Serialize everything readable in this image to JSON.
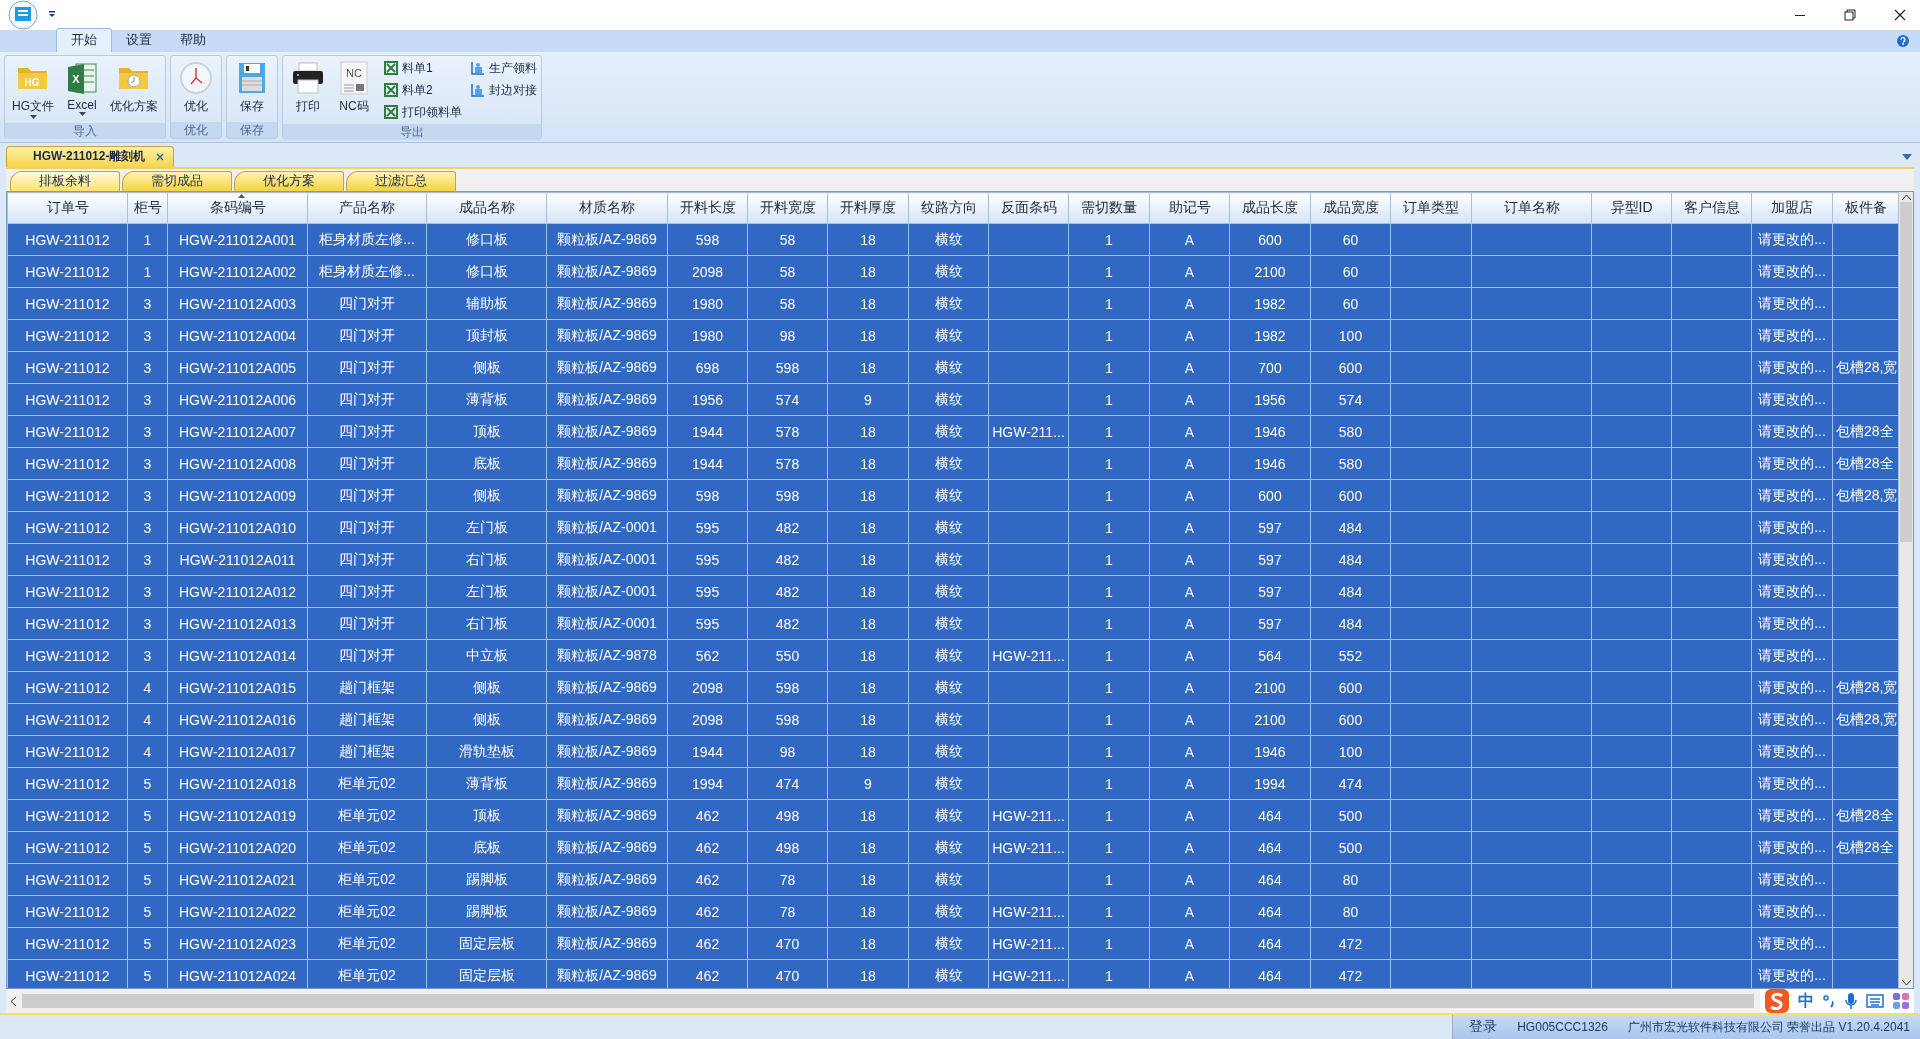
{
  "ribbon": {
    "tabs": [
      {
        "label": "开始",
        "selected": true
      },
      {
        "label": "设置",
        "selected": false
      },
      {
        "label": "帮助",
        "selected": false
      }
    ],
    "groups": [
      {
        "label": "导入",
        "buttons": [
          {
            "kind": "large",
            "label": "HG文件",
            "badge": "HG",
            "has_menu": true
          },
          {
            "kind": "large",
            "label": "Excel",
            "badge": "X",
            "has_menu": true
          },
          {
            "kind": "large",
            "label": "优化方案",
            "has_menu": false
          }
        ]
      },
      {
        "label": "优化",
        "buttons": [
          {
            "kind": "large",
            "label": "优化",
            "has_menu": false
          }
        ]
      },
      {
        "label": "保存",
        "buttons": [
          {
            "kind": "large",
            "label": "保存",
            "has_menu": false
          }
        ]
      },
      {
        "label": "导出",
        "buttons": [
          {
            "kind": "large",
            "label": "打印",
            "has_menu": false
          },
          {
            "kind": "large",
            "label": "NC码",
            "badge": "NC",
            "has_menu": false
          },
          {
            "kind": "small",
            "label": "料单1"
          },
          {
            "kind": "small",
            "label": "料单2"
          },
          {
            "kind": "small",
            "label": "打印领料单"
          },
          {
            "kind": "small",
            "label": "生产领料"
          },
          {
            "kind": "small",
            "label": "封边对接"
          }
        ]
      }
    ]
  },
  "document_tab": {
    "label": "HGW-211012-雕刻机"
  },
  "sub_tabs": [
    {
      "label": "排板余料",
      "selected": true
    },
    {
      "label": "需切成品",
      "selected": false
    },
    {
      "label": "优化方案",
      "selected": false
    },
    {
      "label": "过滤汇总",
      "selected": false
    }
  ],
  "table": {
    "columns": [
      {
        "label": "订单号",
        "sorted": false
      },
      {
        "label": "柜号",
        "sorted": false
      },
      {
        "label": "条码编号",
        "sorted": true
      },
      {
        "label": "产品名称",
        "sorted": false
      },
      {
        "label": "成品名称",
        "sorted": false
      },
      {
        "label": "材质名称",
        "sorted": false
      },
      {
        "label": "开料长度",
        "sorted": false
      },
      {
        "label": "开料宽度",
        "sorted": false
      },
      {
        "label": "开料厚度",
        "sorted": false
      },
      {
        "label": "纹路方向",
        "sorted": false
      },
      {
        "label": "反面条码",
        "sorted": false
      },
      {
        "label": "需切数量",
        "sorted": false
      },
      {
        "label": "助记号",
        "sorted": false
      },
      {
        "label": "成品长度",
        "sorted": false
      },
      {
        "label": "成品宽度",
        "sorted": false
      },
      {
        "label": "订单类型",
        "sorted": false
      },
      {
        "label": "订单名称",
        "sorted": false
      },
      {
        "label": "异型ID",
        "sorted": false
      },
      {
        "label": "客户信息",
        "sorted": false
      },
      {
        "label": "加盟店",
        "sorted": false
      },
      {
        "label": "板件备",
        "sorted": false
      }
    ],
    "rows": [
      {
        "selected": true,
        "cells": [
          "HGW-211012",
          "1",
          "HGW-211012A001",
          "柜身材质左修...",
          "修口板",
          "颗粒板/AZ-9869",
          "598",
          "58",
          "18",
          "横纹",
          "",
          "1",
          "A",
          "600",
          "60",
          "",
          "",
          "",
          "",
          "请更改的...",
          ""
        ]
      },
      {
        "selected": true,
        "cells": [
          "HGW-211012",
          "1",
          "HGW-211012A002",
          "柜身材质左修...",
          "修口板",
          "颗粒板/AZ-9869",
          "2098",
          "58",
          "18",
          "横纹",
          "",
          "1",
          "A",
          "2100",
          "60",
          "",
          "",
          "",
          "",
          "请更改的...",
          ""
        ]
      },
      {
        "selected": true,
        "cells": [
          "HGW-211012",
          "3",
          "HGW-211012A003",
          "四门对开",
          "辅助板",
          "颗粒板/AZ-9869",
          "1980",
          "58",
          "18",
          "横纹",
          "",
          "1",
          "A",
          "1982",
          "60",
          "",
          "",
          "",
          "",
          "请更改的...",
          ""
        ]
      },
      {
        "selected": true,
        "cells": [
          "HGW-211012",
          "3",
          "HGW-211012A004",
          "四门对开",
          "顶封板",
          "颗粒板/AZ-9869",
          "1980",
          "98",
          "18",
          "横纹",
          "",
          "1",
          "A",
          "1982",
          "100",
          "",
          "",
          "",
          "",
          "请更改的...",
          ""
        ]
      },
      {
        "selected": true,
        "cells": [
          "HGW-211012",
          "3",
          "HGW-211012A005",
          "四门对开",
          "侧板",
          "颗粒板/AZ-9869",
          "698",
          "598",
          "18",
          "横纹",
          "",
          "1",
          "A",
          "700",
          "600",
          "",
          "",
          "",
          "",
          "请更改的...",
          "包槽28,宽"
        ]
      },
      {
        "selected": true,
        "cells": [
          "HGW-211012",
          "3",
          "HGW-211012A006",
          "四门对开",
          "薄背板",
          "颗粒板/AZ-9869",
          "1956",
          "574",
          "9",
          "横纹",
          "",
          "1",
          "A",
          "1956",
          "574",
          "",
          "",
          "",
          "",
          "请更改的...",
          ""
        ]
      },
      {
        "selected": true,
        "cells": [
          "HGW-211012",
          "3",
          "HGW-211012A007",
          "四门对开",
          "顶板",
          "颗粒板/AZ-9869",
          "1944",
          "578",
          "18",
          "横纹",
          "HGW-211...",
          "1",
          "A",
          "1946",
          "580",
          "",
          "",
          "",
          "",
          "请更改的...",
          "包槽28全"
        ]
      },
      {
        "selected": true,
        "cells": [
          "HGW-211012",
          "3",
          "HGW-211012A008",
          "四门对开",
          "底板",
          "颗粒板/AZ-9869",
          "1944",
          "578",
          "18",
          "横纹",
          "",
          "1",
          "A",
          "1946",
          "580",
          "",
          "",
          "",
          "",
          "请更改的...",
          "包槽28全"
        ]
      },
      {
        "selected": true,
        "cells": [
          "HGW-211012",
          "3",
          "HGW-211012A009",
          "四门对开",
          "侧板",
          "颗粒板/AZ-9869",
          "598",
          "598",
          "18",
          "横纹",
          "",
          "1",
          "A",
          "600",
          "600",
          "",
          "",
          "",
          "",
          "请更改的...",
          "包槽28,宽"
        ]
      },
      {
        "selected": true,
        "cells": [
          "HGW-211012",
          "3",
          "HGW-211012A010",
          "四门对开",
          "左门板",
          "颗粒板/AZ-0001",
          "595",
          "482",
          "18",
          "横纹",
          "",
          "1",
          "A",
          "597",
          "484",
          "",
          "",
          "",
          "",
          "请更改的...",
          ""
        ]
      },
      {
        "selected": true,
        "cells": [
          "HGW-211012",
          "3",
          "HGW-211012A011",
          "四门对开",
          "右门板",
          "颗粒板/AZ-0001",
          "595",
          "482",
          "18",
          "横纹",
          "",
          "1",
          "A",
          "597",
          "484",
          "",
          "",
          "",
          "",
          "请更改的...",
          ""
        ]
      },
      {
        "selected": true,
        "cells": [
          "HGW-211012",
          "3",
          "HGW-211012A012",
          "四门对开",
          "左门板",
          "颗粒板/AZ-0001",
          "595",
          "482",
          "18",
          "横纹",
          "",
          "1",
          "A",
          "597",
          "484",
          "",
          "",
          "",
          "",
          "请更改的...",
          ""
        ]
      },
      {
        "selected": true,
        "cells": [
          "HGW-211012",
          "3",
          "HGW-211012A013",
          "四门对开",
          "右门板",
          "颗粒板/AZ-0001",
          "595",
          "482",
          "18",
          "横纹",
          "",
          "1",
          "A",
          "597",
          "484",
          "",
          "",
          "",
          "",
          "请更改的...",
          ""
        ]
      },
      {
        "selected": true,
        "cells": [
          "HGW-211012",
          "3",
          "HGW-211012A014",
          "四门对开",
          "中立板",
          "颗粒板/AZ-9878",
          "562",
          "550",
          "18",
          "横纹",
          "HGW-211...",
          "1",
          "A",
          "564",
          "552",
          "",
          "",
          "",
          "",
          "请更改的...",
          ""
        ]
      },
      {
        "selected": true,
        "cells": [
          "HGW-211012",
          "4",
          "HGW-211012A015",
          "趟门框架",
          "侧板",
          "颗粒板/AZ-9869",
          "2098",
          "598",
          "18",
          "横纹",
          "",
          "1",
          "A",
          "2100",
          "600",
          "",
          "",
          "",
          "",
          "请更改的...",
          "包槽28,宽"
        ]
      },
      {
        "selected": true,
        "cells": [
          "HGW-211012",
          "4",
          "HGW-211012A016",
          "趟门框架",
          "侧板",
          "颗粒板/AZ-9869",
          "2098",
          "598",
          "18",
          "横纹",
          "",
          "1",
          "A",
          "2100",
          "600",
          "",
          "",
          "",
          "",
          "请更改的...",
          "包槽28,宽"
        ]
      },
      {
        "selected": true,
        "cells": [
          "HGW-211012",
          "4",
          "HGW-211012A017",
          "趟门框架",
          "滑轨垫板",
          "颗粒板/AZ-9869",
          "1944",
          "98",
          "18",
          "横纹",
          "",
          "1",
          "A",
          "1946",
          "100",
          "",
          "",
          "",
          "",
          "请更改的...",
          ""
        ]
      },
      {
        "selected": true,
        "cells": [
          "HGW-211012",
          "5",
          "HGW-211012A018",
          "柜单元02",
          "薄背板",
          "颗粒板/AZ-9869",
          "1994",
          "474",
          "9",
          "横纹",
          "",
          "1",
          "A",
          "1994",
          "474",
          "",
          "",
          "",
          "",
          "请更改的...",
          ""
        ]
      },
      {
        "selected": true,
        "cells": [
          "HGW-211012",
          "5",
          "HGW-211012A019",
          "柜单元02",
          "顶板",
          "颗粒板/AZ-9869",
          "462",
          "498",
          "18",
          "横纹",
          "HGW-211...",
          "1",
          "A",
          "464",
          "500",
          "",
          "",
          "",
          "",
          "请更改的...",
          "包槽28全"
        ]
      },
      {
        "selected": true,
        "cells": [
          "HGW-211012",
          "5",
          "HGW-211012A020",
          "柜单元02",
          "底板",
          "颗粒板/AZ-9869",
          "462",
          "498",
          "18",
          "横纹",
          "HGW-211...",
          "1",
          "A",
          "464",
          "500",
          "",
          "",
          "",
          "",
          "请更改的...",
          "包槽28全"
        ]
      },
      {
        "selected": true,
        "cells": [
          "HGW-211012",
          "5",
          "HGW-211012A021",
          "柜单元02",
          "踢脚板",
          "颗粒板/AZ-9869",
          "462",
          "78",
          "18",
          "横纹",
          "",
          "1",
          "A",
          "464",
          "80",
          "",
          "",
          "",
          "",
          "请更改的...",
          ""
        ]
      },
      {
        "selected": true,
        "cells": [
          "HGW-211012",
          "5",
          "HGW-211012A022",
          "柜单元02",
          "踢脚板",
          "颗粒板/AZ-9869",
          "462",
          "78",
          "18",
          "横纹",
          "HGW-211...",
          "1",
          "A",
          "464",
          "80",
          "",
          "",
          "",
          "",
          "请更改的...",
          ""
        ]
      },
      {
        "selected": true,
        "cells": [
          "HGW-211012",
          "5",
          "HGW-211012A023",
          "柜单元02",
          "固定层板",
          "颗粒板/AZ-9869",
          "462",
          "470",
          "18",
          "横纹",
          "HGW-211...",
          "1",
          "A",
          "464",
          "472",
          "",
          "",
          "",
          "",
          "请更改的...",
          ""
        ]
      },
      {
        "selected": true,
        "cells": [
          "HGW-211012",
          "5",
          "HGW-211012A024",
          "柜单元02",
          "固定层板",
          "颗粒板/AZ-9869",
          "462",
          "470",
          "18",
          "横纹",
          "HGW-211...",
          "1",
          "A",
          "464",
          "472",
          "",
          "",
          "",
          "",
          "请更改的...",
          ""
        ]
      }
    ]
  },
  "ime_toolbar": {
    "mode": "中"
  },
  "status_bar": {
    "items": [
      "登录",
      "HG005CCC1326",
      "广州市宏光软件科技有限公司 荣誉出品 V1.20.4.2041"
    ]
  }
}
